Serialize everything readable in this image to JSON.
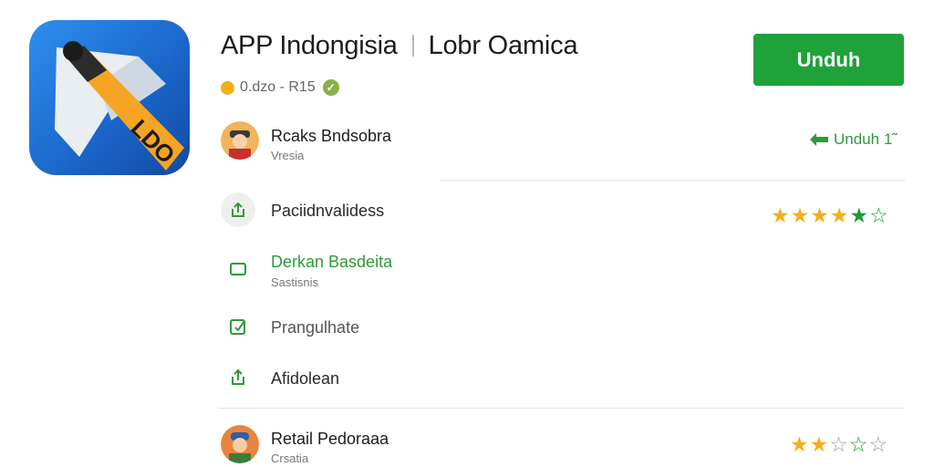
{
  "app": {
    "title": "APP Indongisia",
    "publisher": "Lobr Oamica",
    "meta": "0.dzo - R15",
    "icon_text": "LDO"
  },
  "actions": {
    "install_label": "Unduh",
    "side_download_label": "Unduh 1̃"
  },
  "review1": {
    "title": "Rcaks Bndsobra",
    "subtitle": "Vresia",
    "rating": 5
  },
  "menu": [
    {
      "label": "Paciidnvalidess",
      "icon": "share-icon"
    },
    {
      "label": "Derkan Basdeita",
      "sub": "Sastisnis",
      "icon": "square-icon"
    },
    {
      "label": "Prangulhate",
      "icon": "edit-icon"
    },
    {
      "label": "Afidolean",
      "icon": "upload-icon"
    }
  ],
  "review2": {
    "title": "Retail Pedoraaa",
    "subtitle": "Crsatia",
    "rating": 2
  },
  "colors": {
    "accent": "#1fa23a",
    "star": "#f2b01e",
    "green_text": "#2f9a3a"
  }
}
